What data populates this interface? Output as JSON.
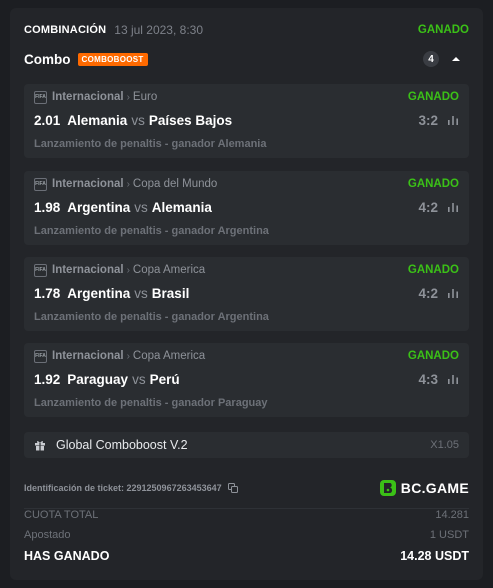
{
  "header": {
    "label": "COMBINACIÓN",
    "date": "13 jul 2023, 8:30",
    "status": "GANADO"
  },
  "combo": {
    "title": "Combo",
    "badge": "COMBOBOOST",
    "count": "4"
  },
  "matches": [
    {
      "league": "Internacional",
      "sub": "Euro",
      "status": "GANADO",
      "odds": "2.01",
      "home": "Alemania",
      "vs": "vs",
      "away": "Países Bajos",
      "score": "3:2",
      "pick": "Lanzamiento de penaltis - ganador Alemania"
    },
    {
      "league": "Internacional",
      "sub": "Copa del Mundo",
      "status": "GANADO",
      "odds": "1.98",
      "home": "Argentina",
      "vs": "vs",
      "away": "Alemania",
      "score": "4:2",
      "pick": "Lanzamiento de penaltis - ganador Argentina"
    },
    {
      "league": "Internacional",
      "sub": "Copa America",
      "status": "GANADO",
      "odds": "1.78",
      "home": "Argentina",
      "vs": "vs",
      "away": "Brasil",
      "score": "4:2",
      "pick": "Lanzamiento de penaltis - ganador Argentina"
    },
    {
      "league": "Internacional",
      "sub": "Copa America",
      "status": "GANADO",
      "odds": "1.92",
      "home": "Paraguay",
      "vs": "vs",
      "away": "Perú",
      "score": "4:3",
      "pick": "Lanzamiento de penaltis - ganador Paraguay"
    }
  ],
  "boost": {
    "text": "Global Comboboost V.2",
    "multiplier": "X1.05"
  },
  "ticket": {
    "label": "Identificación de ticket: 2291250967263453647"
  },
  "brand": {
    "name": "BC.GAME"
  },
  "summary": {
    "total_odds_label": "CUOTA TOTAL",
    "total_odds_value": "14.281",
    "staked_label": "Apostado",
    "staked_value": "1 USDT",
    "won_label": "HAS GANADO",
    "won_value": "14.28 USDT"
  },
  "colors": {
    "win": "#3bc117",
    "badge": "#ff6a00",
    "card": "#232529",
    "row": "#2a2d31"
  },
  "icons": {
    "fifa": "fifa-logo-icon",
    "stats": "bar-chart-icon",
    "chevron": "chevron-up-icon",
    "gift": "gift-icon",
    "copy": "copy-icon",
    "brand": "bc-game-logo-icon"
  }
}
